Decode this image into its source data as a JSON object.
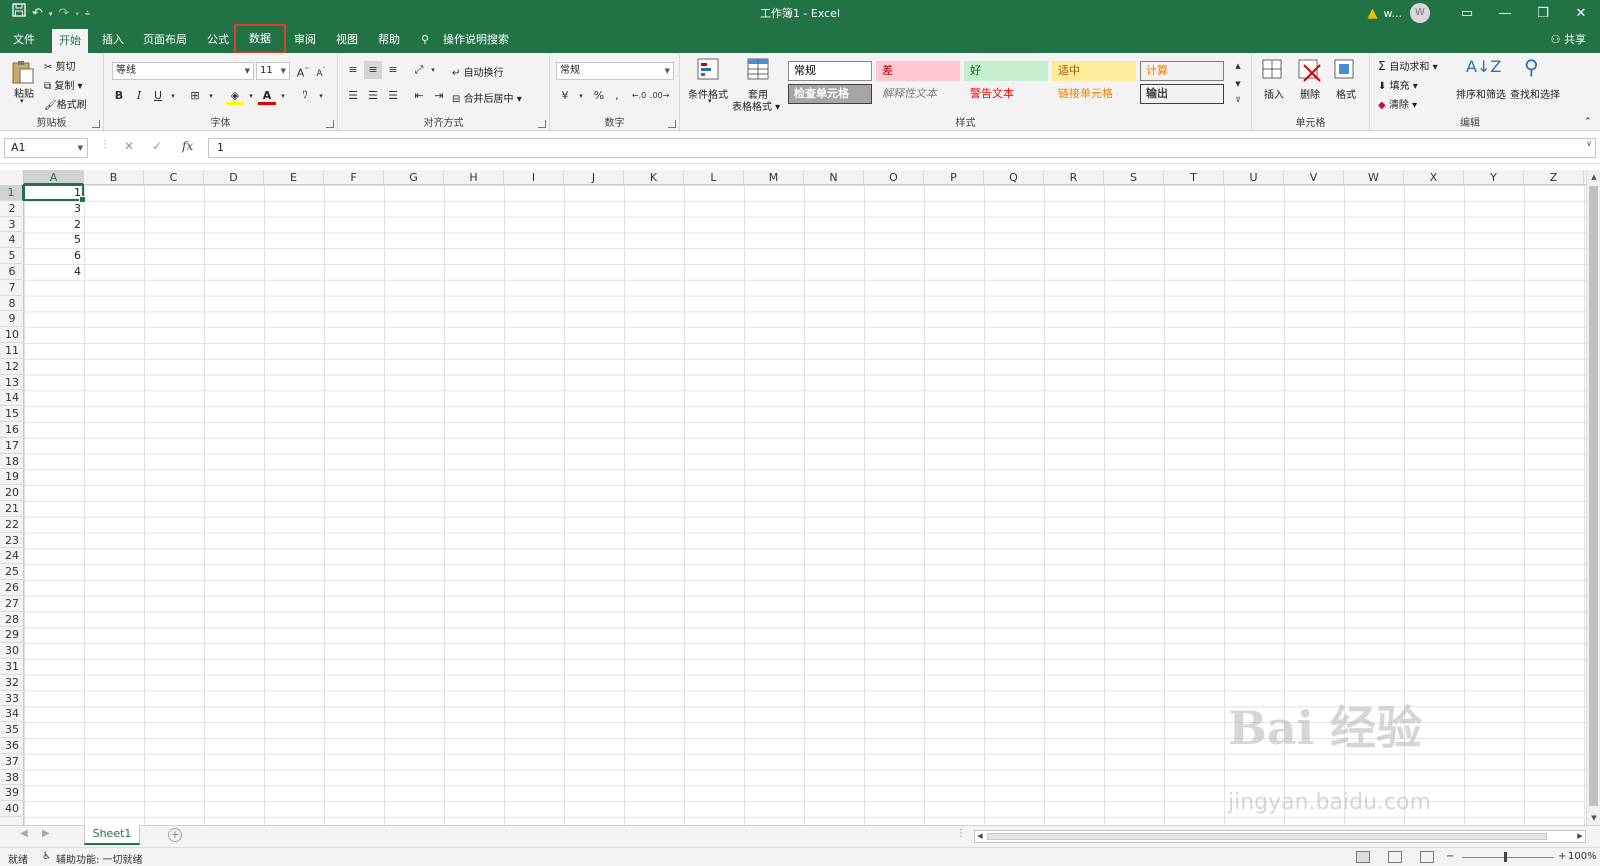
{
  "window": {
    "title": "工作簿1  -  Excel",
    "user": "w...",
    "avatar_initial": "W"
  },
  "tabs": [
    {
      "label": "文件"
    },
    {
      "label": "开始"
    },
    {
      "label": "插入"
    },
    {
      "label": "页面布局"
    },
    {
      "label": "公式"
    },
    {
      "label": "数据"
    },
    {
      "label": "审阅"
    },
    {
      "label": "视图"
    },
    {
      "label": "帮助"
    },
    {
      "label": "操作说明搜索"
    }
  ],
  "share_label": "共享",
  "ribbon": {
    "clipboard": {
      "label": "剪贴板",
      "paste": "粘贴",
      "cut": "剪切",
      "copy": "复制",
      "format_painter": "格式刷"
    },
    "font": {
      "label": "字体",
      "font_name": "等线",
      "font_size": "11",
      "bold": "B",
      "italic": "I",
      "underline": "U"
    },
    "alignment": {
      "label": "对齐方式",
      "wrap_text": "自动换行",
      "merge_center": "合并后居中"
    },
    "number": {
      "label": "数字",
      "format": "常规"
    },
    "styles": {
      "label": "样式",
      "conditional_format": "条件格式",
      "table_format_1": "套用",
      "table_format_2": "表格格式",
      "gallery": [
        {
          "text": "常规",
          "bg": "#ffffff",
          "color": "#000000",
          "border": "#8a8a8a"
        },
        {
          "text": "差",
          "bg": "#ffc7ce",
          "color": "#9c0006",
          "border": "#ffc7ce"
        },
        {
          "text": "好",
          "bg": "#c6efce",
          "color": "#006100",
          "border": "#c6efce"
        },
        {
          "text": "适中",
          "bg": "#ffeb9c",
          "color": "#9c5700",
          "border": "#ffeb9c"
        },
        {
          "text": "计算",
          "bg": "#f2f2f2",
          "color": "#fa7d00",
          "border": "#7f7f7f"
        },
        {
          "text": "检查单元格",
          "bg": "#a5a5a5",
          "color": "#ffffff",
          "border": "#3f3f3f"
        },
        {
          "text": "解释性文本",
          "bg": "#f3f3f3",
          "color": "#7f7f7f",
          "border": "#f3f3f3"
        },
        {
          "text": "警告文本",
          "bg": "#f3f3f3",
          "color": "#ff0000",
          "border": "#f3f3f3"
        },
        {
          "text": "链接单元格",
          "bg": "#f3f3f3",
          "color": "#fa7d00",
          "border": "#f3f3f3"
        },
        {
          "text": "输出",
          "bg": "#f2f2f2",
          "color": "#3f3f3f",
          "border": "#3f3f3f"
        }
      ]
    },
    "cells": {
      "label": "单元格",
      "insert": "插入",
      "delete": "删除",
      "format": "格式"
    },
    "editing": {
      "label": "编辑",
      "autosum": "自动求和",
      "fill": "填充",
      "clear": "清除",
      "sort_filter": "排序和筛选",
      "find_select": "查找和选择"
    }
  },
  "formula_bar": {
    "name_box": "A1",
    "fx": "fx",
    "value": "1"
  },
  "sheet": {
    "columns": [
      "A",
      "B",
      "C",
      "D",
      "E",
      "F",
      "G",
      "H",
      "I",
      "J",
      "K",
      "L",
      "M",
      "N",
      "O",
      "P",
      "Q",
      "R",
      "S",
      "T",
      "U",
      "V",
      "W",
      "X",
      "Y",
      "Z"
    ],
    "row_count": 40,
    "cells_A": [
      "1",
      "3",
      "2",
      "5",
      "6",
      "4"
    ],
    "selected_cell": "A1"
  },
  "sheet_tabs": [
    {
      "label": "Sheet1"
    }
  ],
  "status": {
    "ready": "就绪",
    "accessibility": "辅助功能: 一切就绪",
    "zoom": "100%"
  },
  "watermark": {
    "brand": "Bai 经验",
    "url": "jingyan.baidu.com"
  },
  "colors": {
    "accent": "#217346",
    "highlight_box": "#d9432e"
  }
}
